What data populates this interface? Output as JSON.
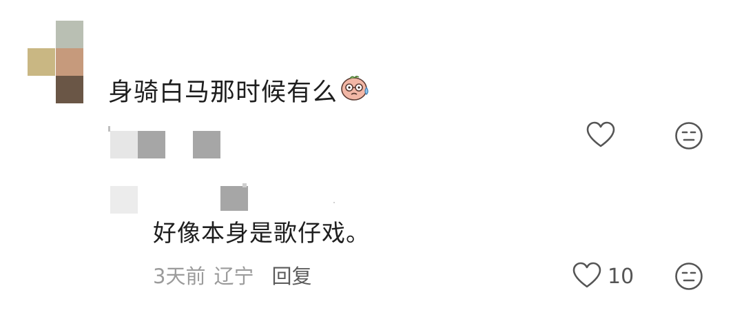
{
  "comment": {
    "text": "身骑白马那时候有么",
    "emoji": "nervous-glasses-face-emoji",
    "like_icon": "heart-outline-icon",
    "dislike_icon": "neutral-face-icon"
  },
  "reply": {
    "text": "好像本身是歌仔戏。",
    "time": "3天前",
    "location": "辽宁",
    "reply_label": "回复",
    "like_count": "10",
    "like_icon": "heart-outline-icon",
    "dislike_icon": "neutral-face-icon"
  },
  "colors": {
    "avatar_top": "#b9bfb3",
    "avatar_left": "#c9b783",
    "avatar_mid": "#c69a7c",
    "avatar_bottom": "#6a5646",
    "pixel_light": "#e6e6e6",
    "pixel_dark": "#a6a6a6",
    "text": "#1e1e1e",
    "meta": "#9b9b9b",
    "icon": "#555555"
  }
}
